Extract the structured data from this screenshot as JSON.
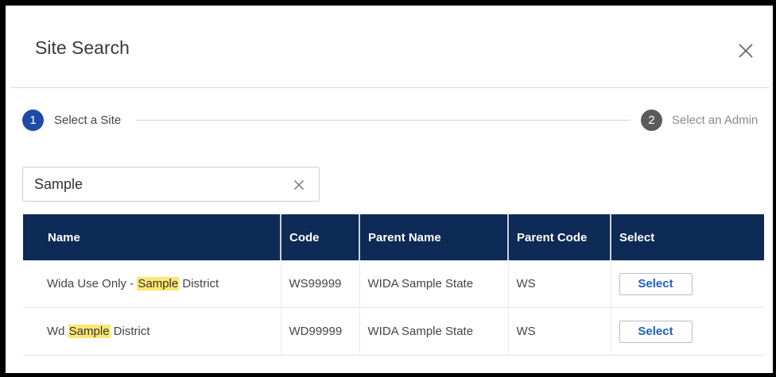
{
  "dialog": {
    "title": "Site Search",
    "close_icon": "close-icon"
  },
  "stepper": {
    "steps": [
      {
        "number": "1",
        "label": "Select a Site",
        "active": true
      },
      {
        "number": "2",
        "label": "Select an Admin",
        "active": false
      }
    ]
  },
  "search": {
    "value": "Sample",
    "clear_icon": "clear-icon"
  },
  "table": {
    "headers": [
      "Name",
      "Code",
      "Parent Name",
      "Parent Code",
      "Select"
    ],
    "rows": [
      {
        "name_before": "Wida Use Only - ",
        "name_highlight": "Sample",
        "name_after": " District",
        "code": "WS99999",
        "parent_name": "WIDA Sample State",
        "parent_code": "WS",
        "action_label": "Select"
      },
      {
        "name_before": "Wd ",
        "name_highlight": "Sample",
        "name_after": " District",
        "code": "WD99999",
        "parent_name": "WIDA Sample State",
        "parent_code": "WS",
        "action_label": "Select"
      }
    ]
  },
  "colors": {
    "header_bg": "#0e2a57",
    "active_step": "#1f4ba5",
    "inactive_step": "#5b5b5b",
    "highlight": "#fde672",
    "select_text": "#1f5fc4"
  }
}
